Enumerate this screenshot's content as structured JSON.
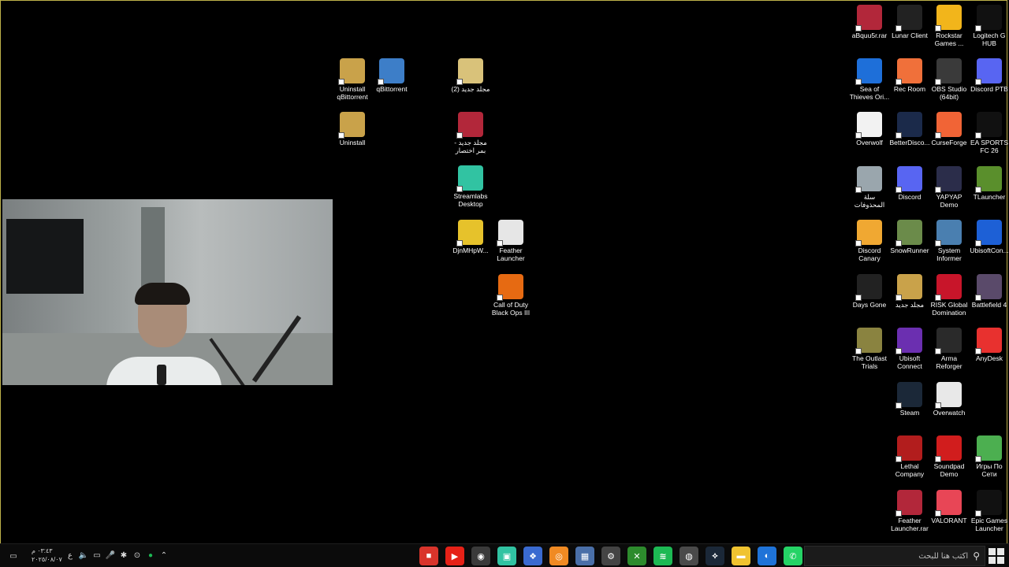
{
  "desktop": {
    "icons_left": [
      {
        "name": "uninstall-qbittorrent",
        "label": "Uninstall qBittorrent",
        "icon": "uninstall-icon",
        "color": "#c9a24a"
      },
      {
        "name": "qbittorrent",
        "label": "qBittorrent",
        "icon": "qbittorrent-icon",
        "color": "#3d7ec8"
      },
      {
        "name": "uninstall",
        "label": "Uninstall",
        "icon": "uninstall-icon",
        "color": "#c9a24a"
      },
      {
        "name": "new-folder-2",
        "label": "(2) مجلد جديد",
        "icon": "steam-archive-icon",
        "color": "#d9c27a"
      },
      {
        "name": "new-folder-shortcut",
        "label": "مجلد جديد - بمر اختصار",
        "icon": "winrar-icon",
        "color": "#b2273a"
      },
      {
        "name": "streamlabs",
        "label": "Streamlabs Desktop",
        "icon": "streamlabs-icon",
        "color": "#31c3a2"
      },
      {
        "name": "djnm",
        "label": "DjnMHpW...",
        "icon": "puzzle-icon",
        "color": "#e6c22b"
      },
      {
        "name": "feather-launcher-desktop",
        "label": "Feather Launcher",
        "icon": "feather-icon",
        "color": "#e6e6e6"
      },
      {
        "name": "cod-bo3",
        "label": "Call of Duty Black Ops III",
        "icon": "cod-icon",
        "color": "#e66a12"
      }
    ],
    "icons_right": [
      {
        "name": "abquu5r",
        "label": "aBquu5r.rar",
        "icon": "winrar-icon",
        "color": "#b2273a"
      },
      {
        "name": "lunar-client",
        "label": "Lunar Client",
        "icon": "lunar-icon",
        "color": "#222222"
      },
      {
        "name": "rockstar",
        "label": "Rockstar Games ...",
        "icon": "rockstar-icon",
        "color": "#f2b51b"
      },
      {
        "name": "logitech",
        "label": "Logitech G HUB",
        "icon": "logitech-icon",
        "color": "#111111"
      },
      {
        "name": "sea-of-thieves",
        "label": "Sea of Thieves Ori...",
        "icon": "music-note-icon",
        "color": "#1e6fd9"
      },
      {
        "name": "rec-room",
        "label": "Rec Room",
        "icon": "recroom-icon",
        "color": "#f0703a"
      },
      {
        "name": "obs",
        "label": "OBS Studio (64bit)",
        "icon": "obs-icon",
        "color": "#3a3a3a"
      },
      {
        "name": "discord-ptb",
        "label": "Discord PTB",
        "icon": "discord-icon",
        "color": "#5865f2"
      },
      {
        "name": "overwolf",
        "label": "Overwolf",
        "icon": "file-icon",
        "color": "#f2f2f2"
      },
      {
        "name": "betterdiscord",
        "label": "BetterDisco...",
        "icon": "betterdiscord-icon",
        "color": "#1b2a4a"
      },
      {
        "name": "curseforge",
        "label": "CurseForge",
        "icon": "anvil-icon",
        "color": "#f16436"
      },
      {
        "name": "ea-fc26",
        "label": "EA SPORTS FC 26",
        "icon": "eafc-icon",
        "color": "#111111"
      },
      {
        "name": "recycle-bin",
        "label": "سلة المحذوفات",
        "icon": "recycle-bin-icon",
        "color": "#9aa6ad"
      },
      {
        "name": "discord",
        "label": "Discord",
        "icon": "discord-icon",
        "color": "#5865f2"
      },
      {
        "name": "yapyap",
        "label": "YAPYAP Demo",
        "icon": "yapyap-icon",
        "color": "#2b2d4a"
      },
      {
        "name": "tlauncher",
        "label": "TLauncher",
        "icon": "minecraft-icon",
        "color": "#5a8f2c"
      },
      {
        "name": "discord-canary",
        "label": "Discord Canary",
        "icon": "discord-icon",
        "color": "#f0a832"
      },
      {
        "name": "snowrunner",
        "label": "SnowRunner",
        "icon": "snowrunner-icon",
        "color": "#6b8b4a"
      },
      {
        "name": "system-informer",
        "label": "System Informer",
        "icon": "system-informer-icon",
        "color": "#4a7fb0"
      },
      {
        "name": "ubisoft-connect-short",
        "label": "UbisoftCon...",
        "icon": "ubisoft-icon",
        "color": "#1d60d6"
      },
      {
        "name": "days-gone",
        "label": "Days Gone",
        "icon": "daysgone-icon",
        "color": "#222222"
      },
      {
        "name": "new-folder",
        "label": "مجلد جديد",
        "icon": "winrar-icon",
        "color": "#c9a24a"
      },
      {
        "name": "risk",
        "label": "RISK Global Domination",
        "icon": "risk-icon",
        "color": "#c8152a"
      },
      {
        "name": "battlefield4",
        "label": "Battlefield 4",
        "icon": "bf4-icon",
        "color": "#5a4a6a"
      },
      {
        "name": "outlast-trials",
        "label": "The Outlast Trials",
        "icon": "outlast-icon",
        "color": "#8a8340"
      },
      {
        "name": "ubisoft-connect",
        "label": "Ubisoft Connect",
        "icon": "ubisoft-icon",
        "color": "#6b2fb0"
      },
      {
        "name": "arma-reforger",
        "label": "Arma Reforger",
        "icon": "arma-icon",
        "color": "#2a2a2a"
      },
      {
        "name": "anydesk",
        "label": "AnyDesk",
        "icon": "anydesk-icon",
        "color": "#e8312f"
      },
      {
        "name": "steam",
        "label": "Steam",
        "icon": "steam-icon",
        "color": "#1b2838"
      },
      {
        "name": "overwatch",
        "label": "Overwatch",
        "icon": "overwatch-icon",
        "color": "#e8e8e8"
      },
      {
        "name": "lethal-company",
        "label": "Lethal Company",
        "icon": "lethal-icon",
        "color": "#b21d1d"
      },
      {
        "name": "soundpad",
        "label": "Soundpad Demo",
        "icon": "soundpad-icon",
        "color": "#d11d1d"
      },
      {
        "name": "ftp",
        "label": "Игры По Сети",
        "icon": "ftp-icon",
        "color": "#4caf50"
      },
      {
        "name": "feather-launcher",
        "label": "Feather Launcher.rar",
        "icon": "winrar-icon",
        "color": "#b2273a"
      },
      {
        "name": "valorant",
        "label": "VALORANT",
        "icon": "valorant-icon",
        "color": "#e84656"
      },
      {
        "name": "epic",
        "label": "Epic Games Launcher",
        "icon": "epic-icon",
        "color": "#111111"
      }
    ]
  },
  "taskbar": {
    "search_placeholder": "اكتب هنا للبحث",
    "time": "٠٣:٤٣ م",
    "date": "٢٠٢٥/٠٨/٠٧",
    "lang": "ع",
    "apps": [
      {
        "name": "app-red",
        "glyph": "■",
        "color": "#d9342b"
      },
      {
        "name": "app-youtube",
        "glyph": "▶",
        "color": "#e62117"
      },
      {
        "name": "app-obs",
        "glyph": "◉",
        "color": "#3a3a3a"
      },
      {
        "name": "app-streamlabs",
        "glyph": "▣",
        "color": "#31c3a2"
      },
      {
        "name": "app-bf",
        "glyph": "❖",
        "color": "#3a6ad0"
      },
      {
        "name": "app-orange",
        "glyph": "◎",
        "color": "#f08a23"
      },
      {
        "name": "app-window",
        "glyph": "▦",
        "color": "#4a6fa8"
      },
      {
        "name": "app-settings",
        "glyph": "⚙",
        "color": "#444444"
      },
      {
        "name": "app-xbox",
        "glyph": "✕",
        "color": "#2d8b2d"
      },
      {
        "name": "app-spotify",
        "glyph": "≋",
        "color": "#1db954"
      },
      {
        "name": "app-chrome",
        "glyph": "◍",
        "color": "#4a4a4a"
      },
      {
        "name": "app-steam",
        "glyph": "⟡",
        "color": "#1b2838"
      },
      {
        "name": "app-explorer",
        "glyph": "▬",
        "color": "#f0c330"
      },
      {
        "name": "app-edge",
        "glyph": "◐",
        "color": "#1f73d8"
      },
      {
        "name": "app-whatsapp",
        "glyph": "✆",
        "color": "#25d366"
      }
    ]
  }
}
